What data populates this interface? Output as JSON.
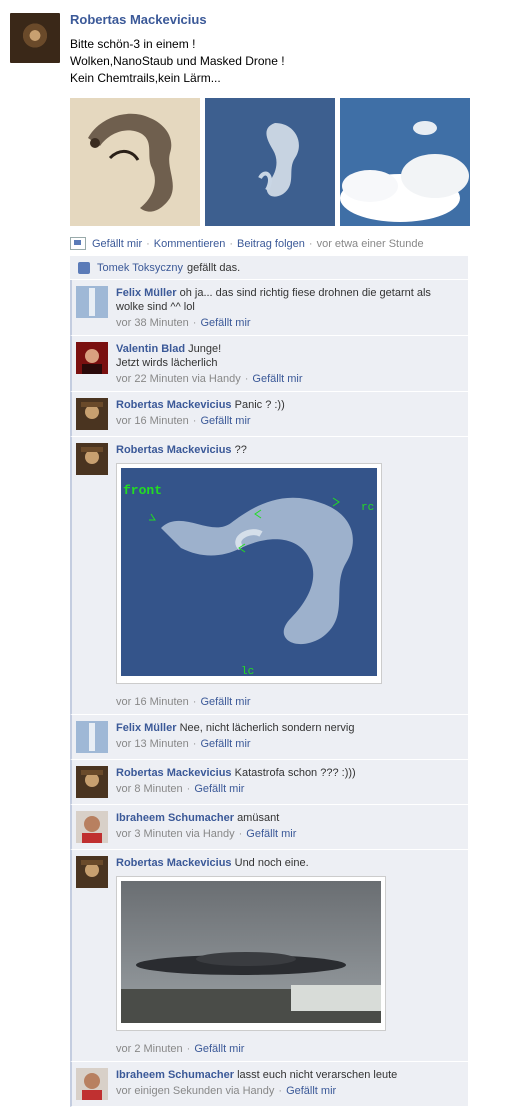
{
  "post": {
    "author": "Robertas Mackevicius",
    "text_lines": [
      "Bitte schön-3 in einem !",
      "Wolken,NanoStaub und Masked Drone !",
      "Kein Chemtrails,kein Lärm..."
    ],
    "actions": {
      "like": "Gefällt mir",
      "comment": "Kommentieren",
      "follow": "Beitrag folgen",
      "time": "vor etwa einer Stunde"
    },
    "likes_user": "Tomek Toksyczny",
    "likes_suffix": "gefällt das."
  },
  "comments": [
    {
      "author": "Felix Müller",
      "text": "oh ja... das sind richtig fiese drohnen die getarnt als wolke sind ^^ lol",
      "time": "vor 38 Minuten",
      "via": "",
      "like": "Gefällt mir"
    },
    {
      "author": "Valentin Blad",
      "text": "Junge!\nJetzt wirds lächerlich",
      "time": "vor 22 Minuten via Handy",
      "via": "",
      "like": "Gefällt mir"
    },
    {
      "author": "Robertas Mackevicius",
      "text": "Panic ? :))",
      "time": "vor 16 Minuten",
      "via": "",
      "like": "Gefällt mir"
    },
    {
      "author": "Robertas Mackevicius",
      "text": "??",
      "time": "vor 16 Minuten",
      "via": "",
      "like": "Gefällt mir",
      "overlay": {
        "front": "front",
        "rc": "rc",
        "lc": "lc"
      }
    },
    {
      "author": "Felix Müller",
      "text": "Nee, nicht lächerlich sondern nervig",
      "time": "vor 13 Minuten",
      "via": "",
      "like": "Gefällt mir"
    },
    {
      "author": "Robertas Mackevicius",
      "text": "Katastrofa schon ??? :)))",
      "time": "vor 8 Minuten",
      "via": "",
      "like": "Gefällt mir"
    },
    {
      "author": "Ibraheem Schumacher",
      "text": "amüsant",
      "time": "vor 3 Minuten via Handy",
      "via": "",
      "like": "Gefällt mir"
    },
    {
      "author": "Robertas Mackevicius",
      "text": "Und noch eine.",
      "time": "vor 2 Minuten",
      "via": "",
      "like": "Gefällt mir"
    },
    {
      "author": "Ibraheem Schumacher",
      "text": "lasst euch nicht verarschen leute",
      "time": "vor einigen Sekunden via Handy",
      "via": "",
      "like": "Gefällt mir"
    }
  ],
  "colors": {
    "link": "#3b5998",
    "ufi_bg": "#edeff4"
  }
}
